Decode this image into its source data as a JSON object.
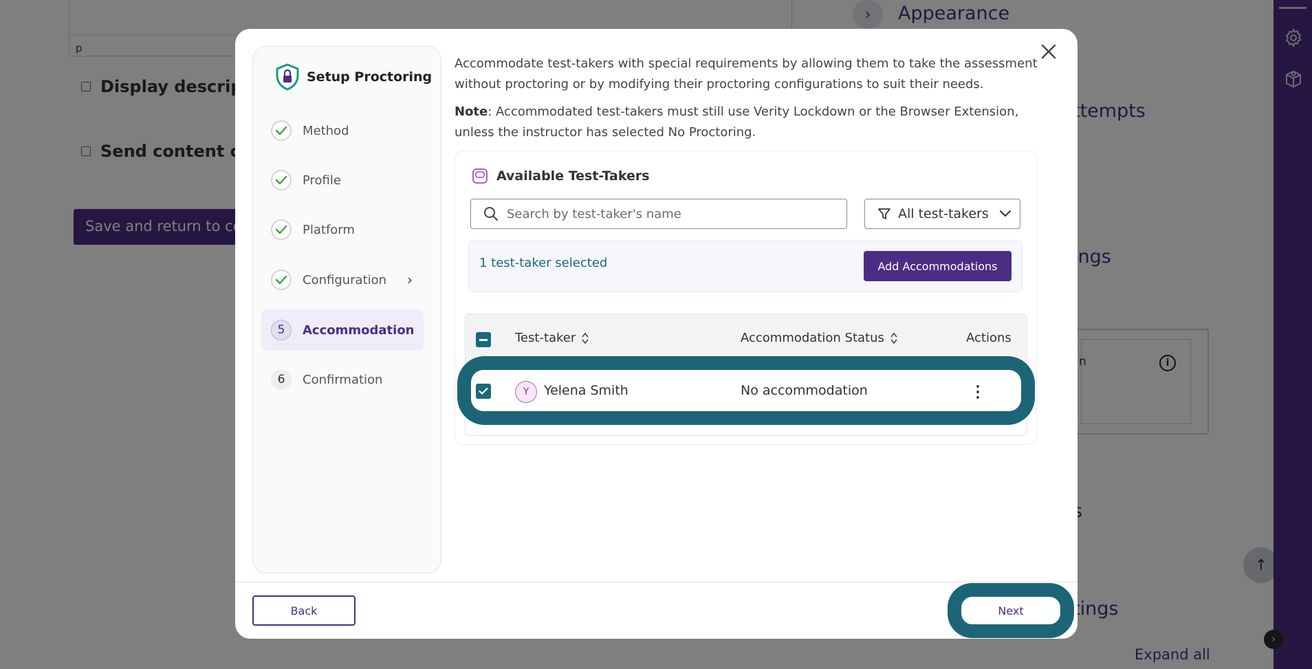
{
  "background": {
    "editor_footer_text": "p",
    "checkbox_display_description": "Display descriptio",
    "checkbox_send_content": "Send content char",
    "save_button": "Save and return to cou",
    "right_labels": {
      "appearance": "Appearance",
      "attempts": "ttempts",
      "settings1": "ings",
      "card_label": "n",
      "label_s": "s",
      "settings2": "tings"
    },
    "expand_all": "Expand all"
  },
  "modal": {
    "title": "Setup Proctoring",
    "steps": [
      {
        "label": "Method",
        "state": "done"
      },
      {
        "label": "Profile",
        "state": "done"
      },
      {
        "label": "Platform",
        "state": "done"
      },
      {
        "label": "Configuration",
        "state": "done"
      },
      {
        "label": "Accommodation",
        "number": "5",
        "state": "active"
      },
      {
        "label": "Confirmation",
        "number": "6",
        "state": "pending"
      }
    ],
    "intro": "Accommodate test-takers with special requirements by allowing them to take the assessment without proctoring or by modifying their proctoring configurations to suit their needs.",
    "note_label": "Note",
    "note_text": ": Accommodated test-takers must still use Verity Lockdown or the Browser Extension, unless the instructor has selected No Proctoring.",
    "panel_title": "Available Test-Takers",
    "search_placeholder": "Search by test-taker's name",
    "filter_label": "All test-takers",
    "selected_text": "1 test-taker selected",
    "add_button": "Add Accommodations",
    "table": {
      "headers": {
        "test_taker": "Test-taker",
        "status": "Accommodation Status",
        "actions": "Actions"
      },
      "rows": [
        {
          "initial": "Y",
          "name": "Yelena Smith",
          "status": "No accommodation"
        }
      ]
    },
    "back_button": "Back",
    "next_button": "Next"
  },
  "colors": {
    "brand": "#4b2e83",
    "teal": "#1b6a7a",
    "highlight": "#1c6577",
    "shield": "#1a9a8a"
  }
}
